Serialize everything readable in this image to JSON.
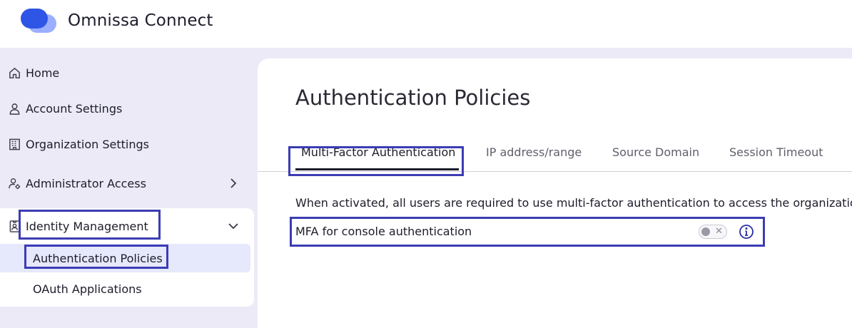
{
  "app": {
    "title": "Omnissa Connect",
    "logo_icon": "omnissa-logo-icon"
  },
  "colors": {
    "highlight": "#3c3cb4",
    "shell_bg": "#eceaf7",
    "active_item_bg": "#e6e8fb",
    "logo_blue": "#2f55e6"
  },
  "sidebar": {
    "items": [
      {
        "label": "Home",
        "icon": "home-icon"
      },
      {
        "label": "Account Settings",
        "icon": "user-icon"
      },
      {
        "label": "Organization Settings",
        "icon": "building-icon"
      },
      {
        "label": "Administrator Access",
        "icon": "user-gear-icon",
        "chevron": "chevron-right-icon"
      },
      {
        "label": "Identity Management",
        "icon": "id-badge-icon",
        "chevron": "chevron-down-icon",
        "children": [
          {
            "label": "Authentication Policies",
            "active": true
          },
          {
            "label": "OAuth Applications"
          }
        ]
      }
    ]
  },
  "main": {
    "title": "Authentication Policies",
    "tabs": [
      {
        "label": "Multi-Factor Authentication",
        "active": true
      },
      {
        "label": "IP address/range"
      },
      {
        "label": "Source Domain"
      },
      {
        "label": "Session Timeout"
      }
    ],
    "description": "When activated, all users are required to use multi-factor authentication to access the organization.",
    "mfa_setting": {
      "label": "MFA for console authentication",
      "enabled": false,
      "toggle_icon": "close-icon",
      "info_icon": "info-icon"
    }
  }
}
